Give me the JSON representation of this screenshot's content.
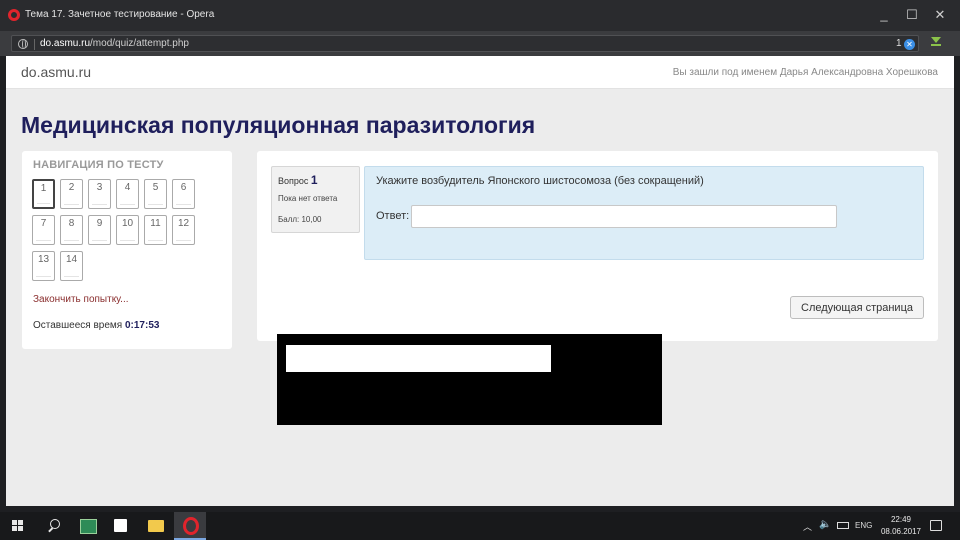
{
  "window": {
    "title": "Тема 17. Зачетное тестирование - Opera",
    "minimize": "_",
    "maximize": "☐",
    "close": "✕"
  },
  "address_bar": {
    "url_host": "do.asmu.ru",
    "url_path": "/mod/quiz/attempt.php",
    "tracker_count": "1",
    "tracker_symbol": "✕"
  },
  "header": {
    "site_name": "do.asmu.ru",
    "login_info": "Вы зашли под именем Дарья Александровна Хорешкова"
  },
  "course_title": "Медицинская популяционная паразитология",
  "nav": {
    "heading": "НАВИГАЦИЯ ПО ТЕСТУ",
    "questions": [
      "1",
      "2",
      "3",
      "4",
      "5",
      "6",
      "7",
      "8",
      "9",
      "10",
      "11",
      "12",
      "13",
      "14"
    ],
    "current_question": "1",
    "finish_label": "Закончить попытку...",
    "timer_label": "Оставшееся время",
    "timer_value": "0:17:53"
  },
  "question": {
    "label": "Вопрос",
    "number": "1",
    "state": "Пока нет ответа",
    "grade": "Балл: 10,00",
    "text": "Укажите возбудитель Японского шистосомоза (без сокращений)",
    "answer_label": "Ответ:",
    "answer_value": ""
  },
  "next_button_label": "Следующая страница",
  "taskbar": {
    "tray_lang": "ENG",
    "clock_time": "22:49",
    "clock_date": "08.06.2017"
  }
}
